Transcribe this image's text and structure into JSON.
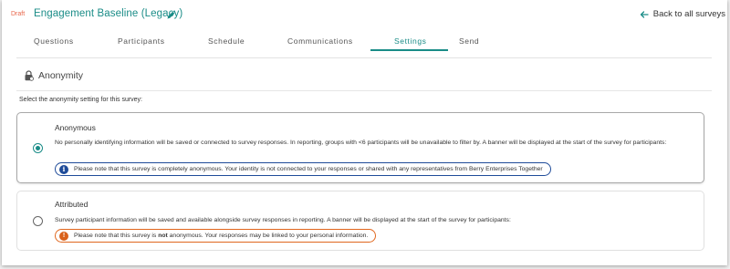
{
  "header": {
    "status": "Draft",
    "title": "Engagement Baseline (Legacy)",
    "back_label": "Back to all surveys",
    "icons": {
      "edit": "pencil-icon",
      "back": "arrow-left-icon"
    }
  },
  "tabs": [
    {
      "label": "Questions"
    },
    {
      "label": "Participants"
    },
    {
      "label": "Schedule"
    },
    {
      "label": "Communications"
    },
    {
      "label": "Settings",
      "active": true
    },
    {
      "label": "Send"
    }
  ],
  "section": {
    "title": "Anonymity",
    "icon": "lock-icon",
    "instruction": "Select the anonymity setting for this survey:"
  },
  "options": [
    {
      "title": "Anonymous",
      "selected": true,
      "description": "No personally identifying information will be saved or connected to survey responses. In reporting, groups with <6 participants will be unavailable to filter by. A banner will be displayed at the start of the survey for participants:",
      "note": "Please note that this survey is completely anonymous. Your identity is not connected to your responses or shared with any representatives from Berry Enterprises Together",
      "note_icon": "info-icon"
    },
    {
      "title": "Attributed",
      "selected": false,
      "description": "Survey participant information will be saved and available alongside survey responses in reporting. A banner will be displayed at the start of the survey for participants:",
      "note_before": "Please note that this survey is ",
      "note_bold": "not",
      "note_after": " anonymous. Your responses may be linked to your personal information.",
      "note_icon": "warning-icon"
    }
  ],
  "colors": {
    "accent": "#1a8c87",
    "draft": "#e8664a",
    "info": "#1f4b99",
    "warning": "#d9621c"
  }
}
